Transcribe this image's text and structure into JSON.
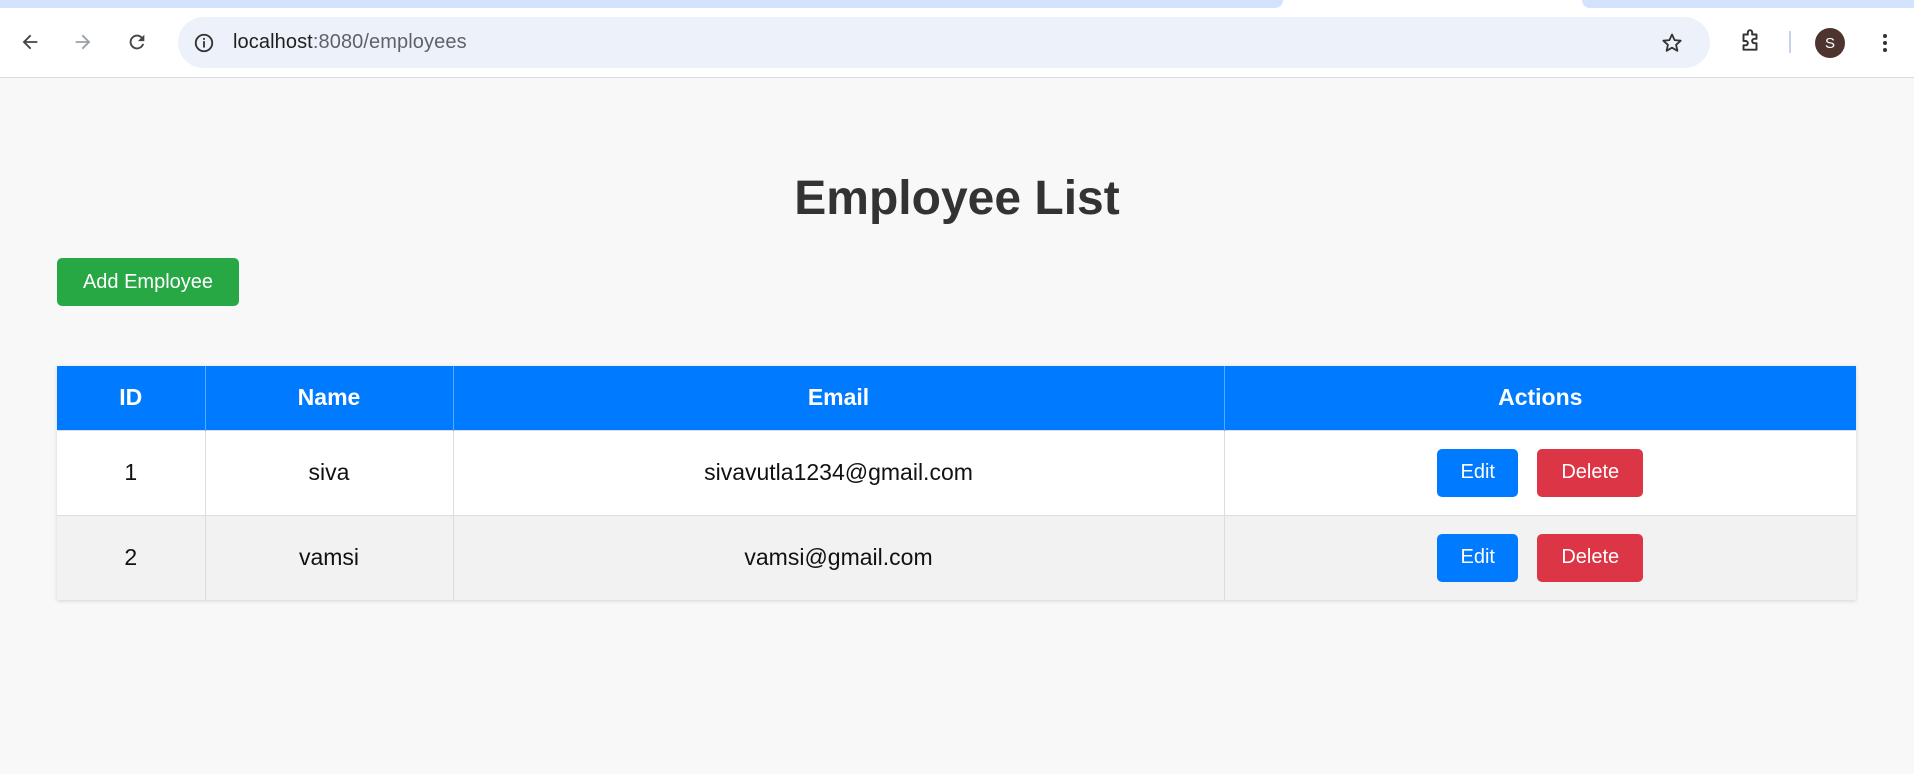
{
  "browser": {
    "url_host": "localhost",
    "url_path": ":8080/employees",
    "profile_initial": "S",
    "icons": {
      "back": "arrow-left-icon",
      "forward": "arrow-right-icon",
      "reload": "reload-icon",
      "site_info": "info-icon",
      "bookmark": "star-icon",
      "extensions": "puzzle-icon",
      "menu": "kebab-menu-icon"
    }
  },
  "page": {
    "title": "Employee List",
    "add_button_label": "Add Employee"
  },
  "table": {
    "headers": [
      "ID",
      "Name",
      "Email",
      "Actions"
    ],
    "rows": [
      {
        "id": "1",
        "name": "siva",
        "email": "sivavutla1234@gmail.com",
        "edit_label": "Edit",
        "delete_label": "Delete"
      },
      {
        "id": "2",
        "name": "vamsi",
        "email": "vamsi@gmail.com",
        "edit_label": "Edit",
        "delete_label": "Delete"
      }
    ]
  },
  "colors": {
    "header_bg": "#007bff",
    "add_button": "#28a745",
    "edit_button": "#007bff",
    "delete_button": "#dc3545",
    "title_text": "#333333"
  }
}
